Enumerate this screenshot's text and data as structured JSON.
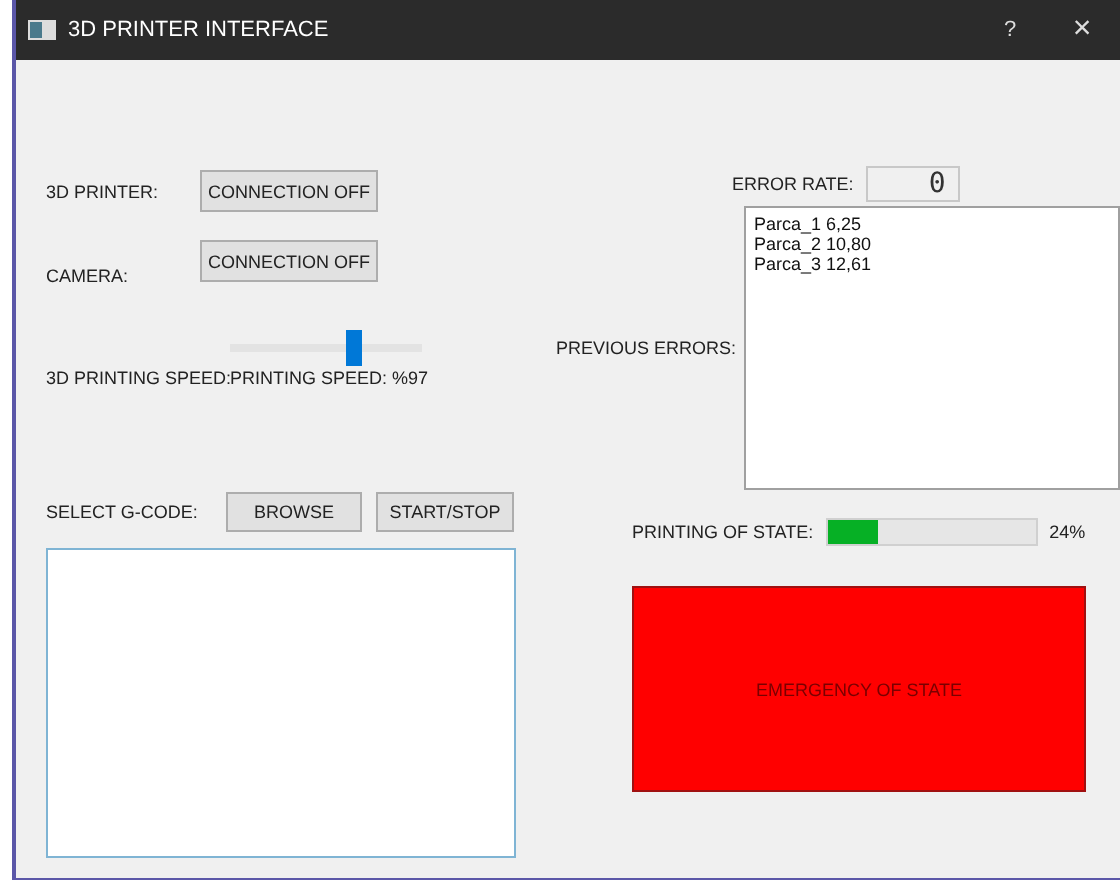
{
  "window": {
    "title": "3D PRINTER INTERFACE",
    "help": "?",
    "close": "×"
  },
  "printer": {
    "label": "3D PRINTER:",
    "button": "CONNECTION OFF"
  },
  "camera": {
    "label": "CAMERA:",
    "button": "CONNECTION OFF"
  },
  "speed": {
    "label": "3D  PRINTING SPEED:",
    "level": 0.65,
    "reading": "PRINTING SPEED: %97"
  },
  "gcode": {
    "label": "SELECT G-CODE:",
    "buttons": [
      "BROWSE",
      "START/STOP"
    ]
  },
  "error_rate": {
    "label": "ERROR RATE:",
    "value": "0"
  },
  "previous_errors": {
    "label": "PREVIOUS ERRORS:",
    "items": [
      "Parca_1 6,25",
      "Parca_2 10,80",
      "Parca_3 12,61"
    ]
  },
  "progress": {
    "label": "PRINTING OF STATE:",
    "level": 0.24,
    "reading": "24%"
  },
  "emergency": {
    "label": "EMERGENCY OF STATE"
  }
}
